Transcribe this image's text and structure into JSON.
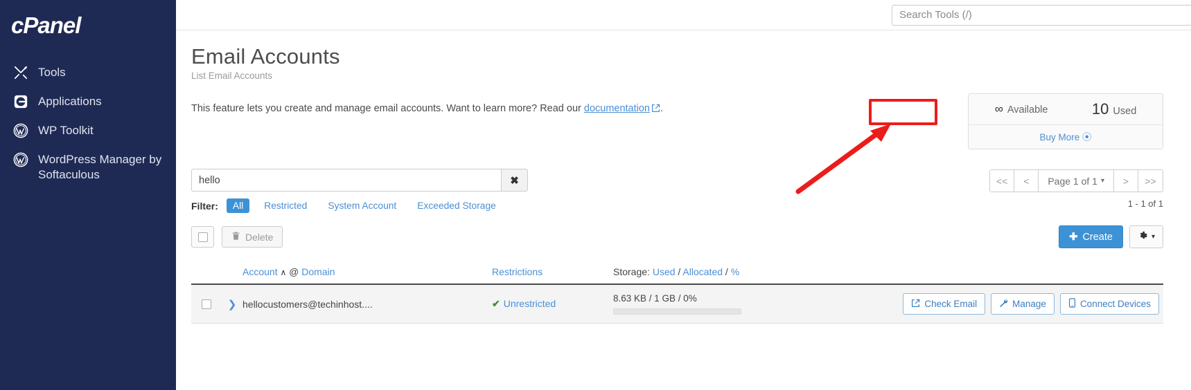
{
  "sidebar": {
    "logo_text": "cPanel",
    "items": [
      {
        "label": "Tools",
        "icon": "tools-icon"
      },
      {
        "label": "Applications",
        "icon": "applications-icon"
      },
      {
        "label": "WP Toolkit",
        "icon": "wordpress-icon"
      },
      {
        "label": "WordPress Manager by Softaculous",
        "icon": "wordpress-icon"
      }
    ]
  },
  "topbar": {
    "search_placeholder": "Search Tools (/)",
    "search_value": ""
  },
  "page": {
    "title": "Email Accounts",
    "subtitle": "List Email Accounts",
    "description_prefix": "This feature lets you create and manage email accounts. Want to learn more? Read our ",
    "description_link": "documentation",
    "description_suffix": "."
  },
  "quota": {
    "available_value": "∞",
    "available_label": "Available",
    "used_value": "10",
    "used_label": "Used",
    "buy_more": "Buy More"
  },
  "search": {
    "value": "hello",
    "clear_label": "✖"
  },
  "filter": {
    "label": "Filter:",
    "options": [
      {
        "label": "All",
        "active": true
      },
      {
        "label": "Restricted",
        "active": false
      },
      {
        "label": "System Account",
        "active": false
      },
      {
        "label": "Exceeded Storage",
        "active": false
      }
    ]
  },
  "pagination": {
    "first": "<<",
    "prev": "<",
    "page_label": "Page 1 of 1",
    "next": ">",
    "last": ">>",
    "count_text": "1 - 1 of 1"
  },
  "toolbar": {
    "delete_label": "Delete",
    "create_label": "Create",
    "gear_label": ""
  },
  "table": {
    "headers": {
      "account": "Account",
      "sort_caret": "∧",
      "at": "@",
      "domain": "Domain",
      "restrictions": "Restrictions",
      "storage_prefix": "Storage:",
      "storage_used": "Used",
      "storage_sep1": "/",
      "storage_allocated": "Allocated",
      "storage_sep2": "/",
      "storage_percent": "%"
    },
    "rows": [
      {
        "account": "hellocustomers@techinhost....",
        "restriction_icon": "✔",
        "restriction": "Unrestricted",
        "storage": "8.63 KB / 1 GB / 0%",
        "storage_percent": 0,
        "actions": [
          {
            "label": "Check Email",
            "icon": "external-link-icon"
          },
          {
            "label": "Manage",
            "icon": "wrench-icon"
          },
          {
            "label": "Connect Devices",
            "icon": "mobile-icon"
          }
        ]
      }
    ]
  },
  "annotations": {
    "highlight_color": "#ec1c1c",
    "highlight_target": "Manage"
  }
}
